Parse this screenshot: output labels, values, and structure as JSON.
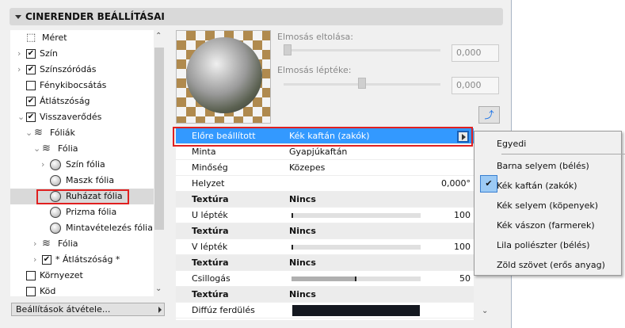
{
  "header": {
    "title": "CINERENDER BEÁLLÍTÁSAI"
  },
  "tree": {
    "items": [
      {
        "label": "Méret",
        "icon": "size-icon"
      },
      {
        "label": "Szín",
        "checked": true
      },
      {
        "label": "Színszóródás",
        "checked": true
      },
      {
        "label": "Fénykibocsátás",
        "checked": false
      },
      {
        "label": "Átlátszóság",
        "checked": true
      },
      {
        "label": "Visszaverődés",
        "checked": true
      },
      {
        "label": "Fóliák",
        "icon": "layers-icon"
      },
      {
        "label": "Fólia",
        "icon": "layers-icon"
      },
      {
        "label": "Szín fólia",
        "icon": "sphere-icon"
      },
      {
        "label": "Maszk fólia",
        "icon": "sphere-icon"
      },
      {
        "label": "Ruházat fólia",
        "icon": "sphere-icon",
        "selected": true
      },
      {
        "label": "Prizma fólia",
        "icon": "sphere-icon"
      },
      {
        "label": "Mintavételezés fólia",
        "icon": "sphere-icon"
      },
      {
        "label": "Fólia",
        "icon": "layers-icon"
      },
      {
        "label": "* Átlátszóság *",
        "checked": true
      },
      {
        "label": "Környezet",
        "checked": false
      },
      {
        "label": "Köd",
        "checked": false
      }
    ]
  },
  "transfer_button": "Beállítások átvétele...",
  "blur": {
    "offset_label": "Elmosás eltolása:",
    "offset_value": "0,000",
    "scale_label": "Elmosás léptéke:",
    "scale_value": "0,000"
  },
  "props": {
    "rows": [
      {
        "key": "Előre beállított",
        "value": "Kék kaftán (zakók)"
      },
      {
        "key": "Minta",
        "value": "Gyapjúkaftán"
      },
      {
        "key": "Minőség",
        "value": "Közepes"
      },
      {
        "key": "Helyzet",
        "num": "0,000°"
      },
      {
        "key": "Textúra",
        "value": "Nincs"
      },
      {
        "key": "U lépték",
        "num": "100",
        "fill": 0
      },
      {
        "key": "Textúra",
        "value": "Nincs"
      },
      {
        "key": "V lépték",
        "num": "100",
        "fill": 0
      },
      {
        "key": "Textúra",
        "value": "Nincs"
      },
      {
        "key": "Csillogás",
        "num": "50",
        "fill": 50
      },
      {
        "key": "Textúra",
        "value": "Nincs"
      },
      {
        "key": "Diffúz ferdülés",
        "color": "#141820"
      }
    ]
  },
  "menu": {
    "custom": "Egyedi",
    "items": [
      "Barna selyem (bélés)",
      "Kék kaftán (zakók)",
      "Kék selyem (köpenyek)",
      "Kék vászon (farmerek)",
      "Lila poliészter (bélés)",
      "Zöld szövet (erős anyag)"
    ],
    "checked_index": 1
  },
  "colors": {
    "selection": "#3399ff",
    "highlight_border": "#e02020"
  }
}
